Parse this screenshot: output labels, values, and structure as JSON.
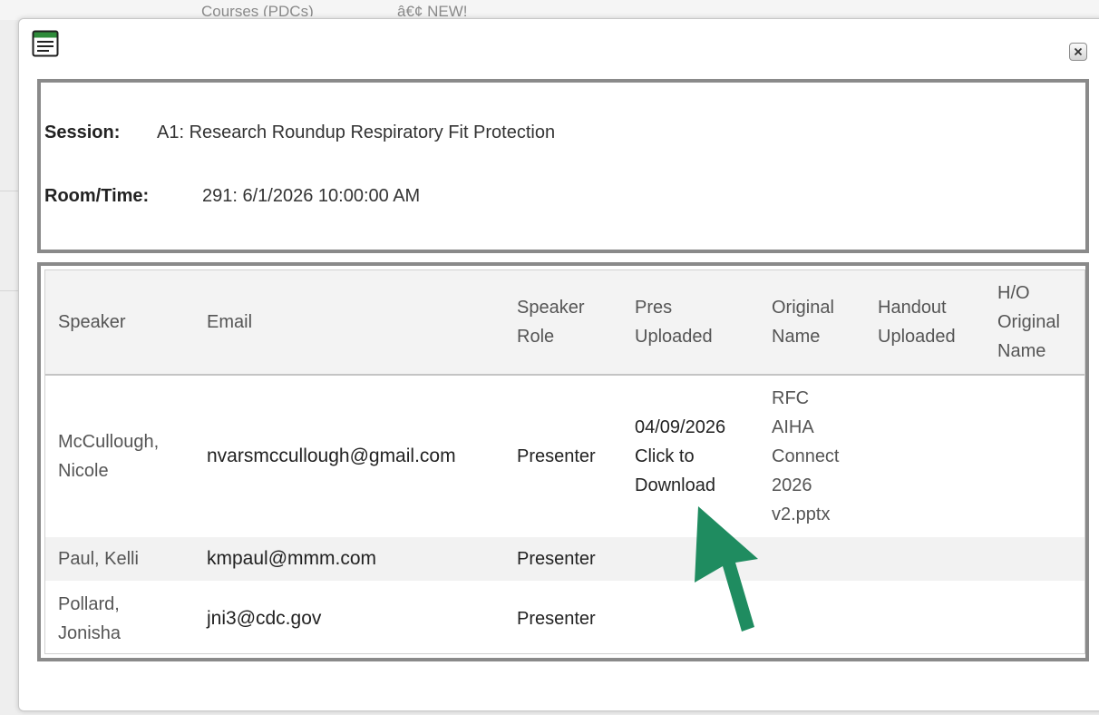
{
  "background": {
    "text_left": "Courses (PDCs)",
    "text_right": "â€¢ NEW!"
  },
  "colors": {
    "arrow": "#1f8c60",
    "panel_border": "#8a8a8a",
    "header_bg": "#f3f3f3"
  },
  "dialog": {
    "icon": "window-list-icon",
    "close_icon": "close-icon"
  },
  "session": {
    "session_label": "Session:",
    "session_value": "A1: Research Roundup Respiratory Fit Protection",
    "room_label": "Room/Time:",
    "room_value": "291: 6/1/2026 10:00:00 AM"
  },
  "table": {
    "columns": [
      [
        "Speaker"
      ],
      [
        "Email"
      ],
      [
        "Speaker",
        "Role"
      ],
      [
        "Pres",
        "Uploaded"
      ],
      [
        "Original",
        "Name"
      ],
      [
        "Handout",
        "Uploaded"
      ],
      [
        "H/O",
        "Original",
        "Name"
      ]
    ],
    "rows": [
      {
        "speaker": [
          "McCullough,",
          "Nicole"
        ],
        "email": "nvarsmccullough@gmail.com",
        "role": "Presenter",
        "pres_uploaded": [
          "04/09/2026",
          "Click to",
          "Download"
        ],
        "original_name": [
          "RFC",
          "AIHA",
          "Connect",
          "2026",
          "v2.pptx"
        ],
        "handout_uploaded": "",
        "ho_original_name": ""
      },
      {
        "speaker": [
          "Paul, Kelli"
        ],
        "email": "kmpaul@mmm.com",
        "role": "Presenter",
        "pres_uploaded": [],
        "original_name": [],
        "handout_uploaded": "",
        "ho_original_name": ""
      },
      {
        "speaker": [
          "Pollard,",
          "Jonisha"
        ],
        "email": "jni3@cdc.gov",
        "role": "Presenter",
        "pres_uploaded": [],
        "original_name": [],
        "handout_uploaded": "",
        "ho_original_name": ""
      }
    ]
  }
}
